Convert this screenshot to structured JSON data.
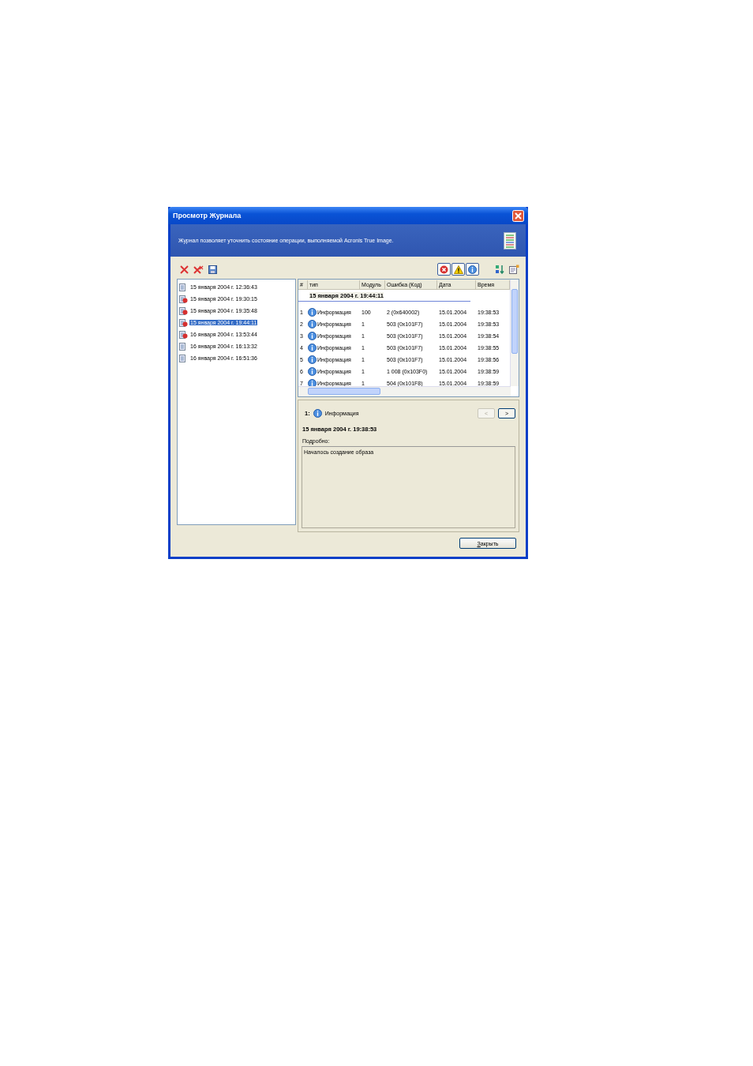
{
  "window": {
    "title": "Просмотр Журнала"
  },
  "header": {
    "description": "Журнал позволяет уточнить состояние операции, выполняемой Acronis True Image."
  },
  "filters": [
    {
      "kind": "error",
      "on": true
    },
    {
      "kind": "warning",
      "on": true
    },
    {
      "kind": "info",
      "on": true
    }
  ],
  "logs": [
    {
      "label": "15 января 2004 г. 12:36:43",
      "kind": "ok",
      "selected": false
    },
    {
      "label": "15 января 2004 г. 19:30:15",
      "kind": "error",
      "selected": false
    },
    {
      "label": "15 января 2004 г. 19:35:48",
      "kind": "error",
      "selected": false
    },
    {
      "label": "15 января 2004 г. 19:44:11",
      "kind": "error",
      "selected": true
    },
    {
      "label": "16 января 2004 г. 13:53:44",
      "kind": "error",
      "selected": false
    },
    {
      "label": "16 января 2004 г. 16:13:32",
      "kind": "ok",
      "selected": false
    },
    {
      "label": "16 января 2004 г. 16:51:36",
      "kind": "ok",
      "selected": false
    }
  ],
  "table": {
    "columns": [
      "#",
      "тип",
      "Модуль",
      "Ошибка (Код)",
      "Дата",
      "Время"
    ],
    "group": "15 января 2004 г. 19:44:11",
    "rows": [
      {
        "num": "1",
        "type": "Информация",
        "module": "100",
        "error": "2 (0x640002)",
        "date": "15.01.2004",
        "time": "19:38:53"
      },
      {
        "num": "2",
        "type": "Информация",
        "module": "1",
        "error": "503 (0x101F7)",
        "date": "15.01.2004",
        "time": "19:38:53"
      },
      {
        "num": "3",
        "type": "Информация",
        "module": "1",
        "error": "503 (0x101F7)",
        "date": "15.01.2004",
        "time": "19:38:54"
      },
      {
        "num": "4",
        "type": "Информация",
        "module": "1",
        "error": "503 (0x101F7)",
        "date": "15.01.2004",
        "time": "19:38:55"
      },
      {
        "num": "5",
        "type": "Информация",
        "module": "1",
        "error": "503 (0x101F7)",
        "date": "15.01.2004",
        "time": "19:38:56"
      },
      {
        "num": "6",
        "type": "Информация",
        "module": "1",
        "error": "1 008 (0x103F0)",
        "date": "15.01.2004",
        "time": "19:38:59"
      },
      {
        "num": "7",
        "type": "Информация",
        "module": "1",
        "error": "504 (0x101F8)",
        "date": "15.01.2004",
        "time": "19:38:59"
      }
    ]
  },
  "details": {
    "index": "1:",
    "type": "Информация",
    "prev": {
      "label": "<",
      "disabled": true
    },
    "next": {
      "label": ">",
      "disabled": false
    },
    "datetime": "15 января 2004 г. 19:38:53",
    "details_label": "Подробно:",
    "text": "Началось создание образа"
  },
  "buttons": [
    {
      "label": "Закрыть"
    }
  ]
}
